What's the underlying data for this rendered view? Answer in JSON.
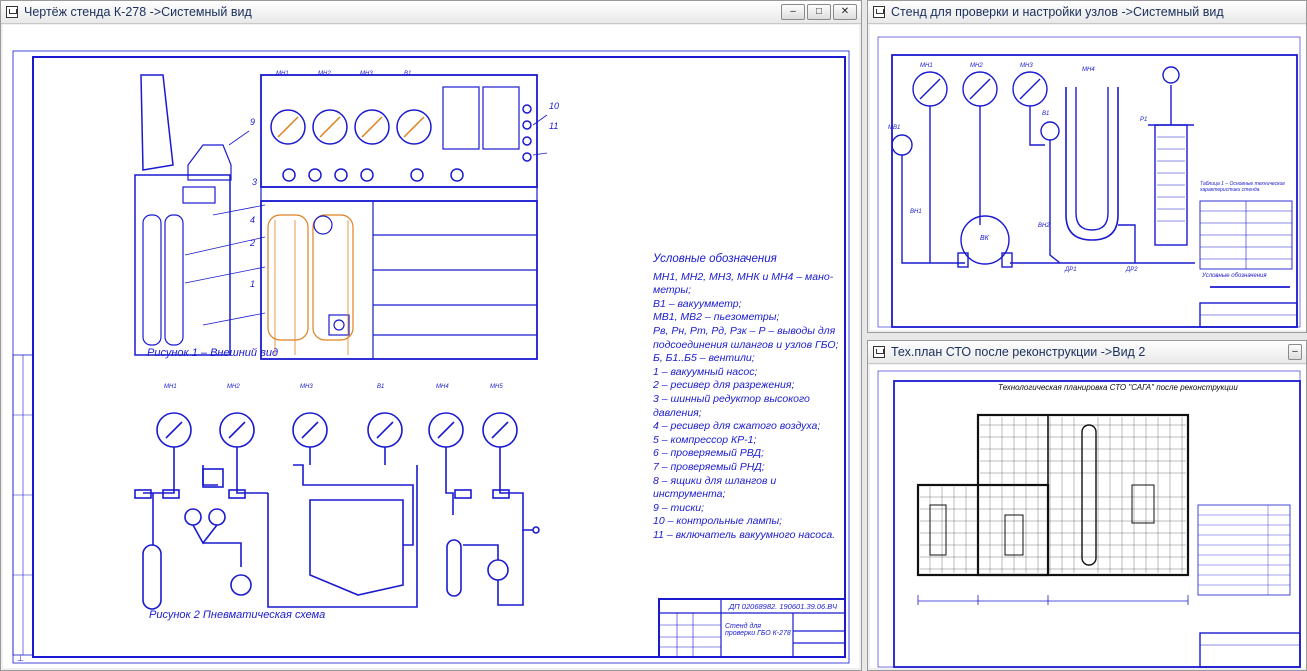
{
  "windows": {
    "main": {
      "title": "Чертёж стенда К-278 ->Системный вид",
      "controls": [
        "–",
        "□",
        "✕"
      ],
      "fig1_caption": "Рисунок 1 – Внешний вид",
      "fig2_caption": "Рисунок 2   Пневматическая схема",
      "legend_title": "Условные обозначения",
      "legend_lines": [
        "МН1, МН2, МН3, МНК и МН4 – мано-метры;",
        "В1 – вакуумметр;",
        "МВ1, МВ2 – пьезометры;",
        "Рв, Рн, Рт, Рд, Рзк – Р – выводы для подсоединения шлангов и узлов ГБО;",
        "Б, Б1..Б5 – вентили;",
        "1 – вакуумный насос;",
        "2 – ресивер для разрежения;",
        "3 – шинный редуктор высокого давления;",
        "4 – ресивер для сжатого воздуха;",
        "5 – компрессор КР-1;",
        "6 – проверяемый РВД;",
        "7 – проверяемый РНД;",
        "8 – ящики для шлангов и инструмента;",
        "9 – тиски;",
        "10 – контрольные лампы;",
        "11 – включатель вакуумного насоса."
      ],
      "stamp_code": "ДП 02068982. 190601.39.06.ВЧ",
      "stamp_title": "Стенд для проверки ГБО К-278",
      "gauge_labels_top": [
        "МН1",
        "МН2",
        "МН3",
        "В1"
      ],
      "gauge_labels_fig2": [
        "МН1",
        "МН2",
        "МН3",
        "В1",
        "МН4",
        "МН5"
      ],
      "callouts_fig1": [
        "1",
        "2",
        "3",
        "4",
        "9",
        "10",
        "11"
      ]
    },
    "right_top": {
      "title": "Стенд для проверки и настройки узлов ->Системный вид",
      "controls": [
        "–",
        "□",
        "✕"
      ],
      "labels": [
        "МН1",
        "МН2",
        "МН3",
        "МН4",
        "МВ1",
        "В1",
        "ВК",
        "ДР1",
        "ДР2",
        "ВН1",
        "ВН2",
        "Р1"
      ],
      "table_note": "Таблица 1 – Основные технические характеристики стенда",
      "legend_label": "Условные обозначения"
    },
    "right_bottom": {
      "title": "Тех.план СТО после реконструкции ->Вид 2",
      "controls": [
        "–",
        "□",
        "✕"
      ],
      "plan_title": "Технологическая планировка СТО \"САГА\" после реконструкции"
    }
  }
}
